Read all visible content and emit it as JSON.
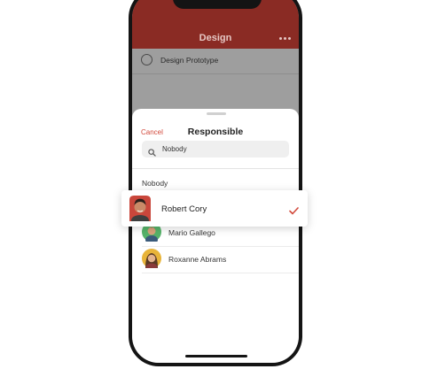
{
  "app": {
    "header_title": "Design",
    "header_color": "#8a2b24",
    "more_icon": "more-dots-icon",
    "task": {
      "label": "Design Prototype"
    }
  },
  "sheet": {
    "cancel_label": "Cancel",
    "title": "Responsible",
    "search": {
      "value": "Nobody",
      "icon": "search-icon"
    },
    "nobody_label": "Nobody",
    "selected": {
      "name": "Robert Cory",
      "check_icon": "checkmark-icon",
      "check_color": "#d24a3c"
    },
    "people": [
      {
        "name": "Mario Gallego",
        "avatar_color": "#56b36a"
      },
      {
        "name": "Roxanne Abrams",
        "avatar_color": "#e8b43a"
      }
    ]
  },
  "colors": {
    "accent": "#d24a3c",
    "selected_avatar_bg": "#c9463b"
  }
}
